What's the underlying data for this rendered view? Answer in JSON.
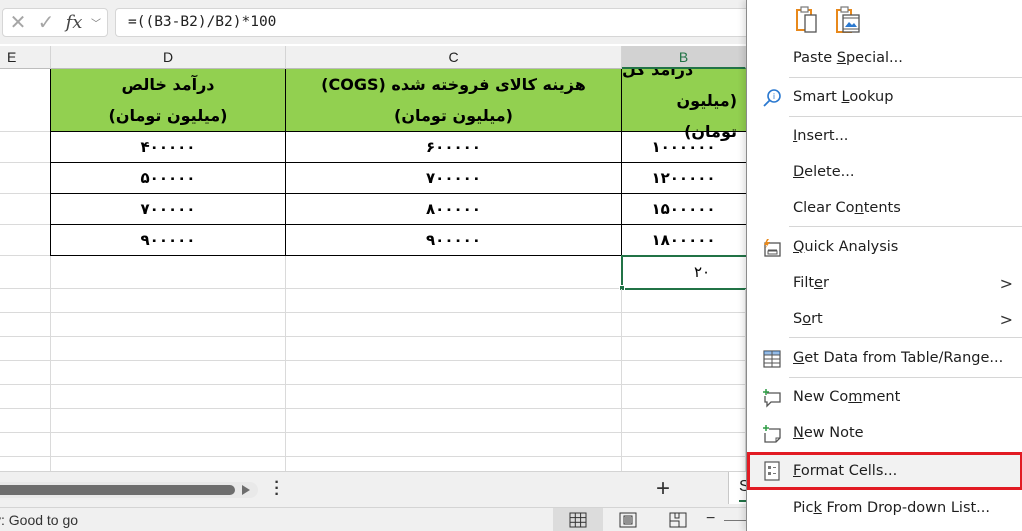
{
  "formula_bar": {
    "cancel_icon": "close-icon",
    "enter_icon": "checkmark-icon",
    "function_label": "fx",
    "formula": "=((B3-B2)/B2)*100"
  },
  "columns": {
    "E": "E",
    "D": "D",
    "C": "C",
    "B": "B"
  },
  "table": {
    "headers": {
      "D": {
        "line1": "درآمد خالص",
        "line2": "(میلیون تومان)"
      },
      "C": {
        "line1": "هزینه کالای فروخته شده (COGS)",
        "line2": "(میلیون تومان)"
      },
      "B": {
        "line1": "درآمد کل",
        "line2": "(میلیون تومان)"
      }
    },
    "rows": [
      {
        "D": "۴۰۰۰۰۰",
        "C": "۶۰۰۰۰۰",
        "B": "۱۰۰۰۰۰۰"
      },
      {
        "D": "۵۰۰۰۰۰",
        "C": "۷۰۰۰۰۰",
        "B": "۱۲۰۰۰۰۰"
      },
      {
        "D": "۷۰۰۰۰۰",
        "C": "۸۰۰۰۰۰",
        "B": "۱۵۰۰۰۰۰"
      },
      {
        "D": "۹۰۰۰۰۰",
        "C": "۹۰۰۰۰۰",
        "B": "۱۸۰۰۰۰۰"
      }
    ],
    "result_cell": "۲۰"
  },
  "sheet_tabs": {
    "add_label": "+",
    "active_tab_partial": "S"
  },
  "status_bar": {
    "text": "y: Good to go",
    "zoom_minus": "−"
  },
  "context_menu": {
    "paste_options": [
      "paste-icon",
      "paste-picture-icon"
    ],
    "items": [
      {
        "id": "paste-special",
        "pre": "Paste ",
        "ul": "S",
        "post": "pecial...",
        "icon": ""
      },
      {
        "id": "smart-lookup",
        "pre": "Smart ",
        "ul": "L",
        "post": "ookup",
        "icon": "smart-lookup-icon"
      },
      {
        "id": "insert",
        "pre": "",
        "ul": "I",
        "post": "nsert...",
        "icon": ""
      },
      {
        "id": "delete",
        "pre": "",
        "ul": "D",
        "post": "elete...",
        "icon": ""
      },
      {
        "id": "clear-contents",
        "pre": "Clear Co",
        "ul": "n",
        "post": "tents",
        "icon": ""
      },
      {
        "id": "quick-analysis",
        "pre": "",
        "ul": "Q",
        "post": "uick Analysis",
        "icon": "quick-analysis-icon"
      },
      {
        "id": "filter",
        "pre": "Filt",
        "ul": "e",
        "post": "r",
        "icon": "",
        "submenu": ">"
      },
      {
        "id": "sort",
        "pre": "S",
        "ul": "o",
        "post": "rt",
        "icon": "",
        "submenu": ">"
      },
      {
        "id": "get-data",
        "pre": "",
        "ul": "G",
        "post": "et Data from Table/Range...",
        "icon": "table-icon"
      },
      {
        "id": "new-comment",
        "pre": "New Co",
        "ul": "m",
        "post": "ment",
        "icon": "new-comment-icon"
      },
      {
        "id": "new-note",
        "pre": "",
        "ul": "N",
        "post": "ew Note",
        "icon": "new-note-icon"
      },
      {
        "id": "format-cells",
        "pre": "",
        "ul": "F",
        "post": "ormat Cells...",
        "icon": "format-cells-icon",
        "highlighted": true
      },
      {
        "id": "pick-from-list",
        "pre": "Pic",
        "ul": "k",
        "post": " From Drop-down List...",
        "icon": ""
      }
    ]
  },
  "colors": {
    "header_fill": "#92d050",
    "excel_green": "#217346",
    "highlight_border": "#e21b23",
    "paste_orange": "#e8891c"
  }
}
